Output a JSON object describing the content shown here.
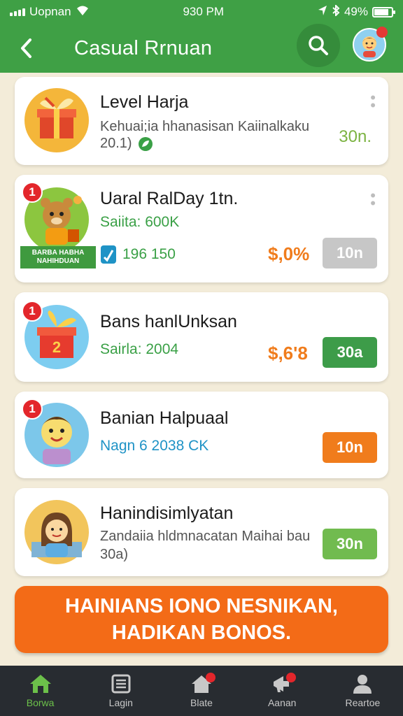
{
  "status_bar": {
    "carrier": "Uopnan",
    "time": "930 PM",
    "battery": "49%"
  },
  "header": {
    "title": "Casual Rrnuan"
  },
  "items": [
    {
      "title": "Level Harja",
      "line1": "Kehuai;ia hhanasisan Kaiinalkaku",
      "line2": "20.1)",
      "amount": "30n."
    },
    {
      "title": "Uaral RalDay 1tn.",
      "line1": "Saiita: 600K",
      "line2": "196 150",
      "price": "$,0%",
      "button": "10n",
      "badge": "1",
      "ribbon": "BARBA HABHA NAHIHDUAN"
    },
    {
      "title": "Bans hanlUnksan",
      "line1": "Sairla: 2004",
      "price": "$,6'8",
      "button": "30a",
      "badge": "1"
    },
    {
      "title": "Banian Halpuaal",
      "line1": "Nagn 6 2038 CK",
      "button": "10n",
      "badge": "1"
    },
    {
      "title": "Hanindisimlyatan",
      "line1": "Zandaiia hldmnacatan Maihai bau",
      "line2": "30a)",
      "button": "30n"
    }
  ],
  "banner": {
    "line1": "HAINIANS IONO NESNIKAN,",
    "line2": "HADIKAN BONOS."
  },
  "tabs": [
    {
      "label": "Borwa"
    },
    {
      "label": "Lagin"
    },
    {
      "label": "Blate"
    },
    {
      "label": "Aanan"
    },
    {
      "label": "Reartoe"
    }
  ],
  "colors": {
    "primary_green": "#3fa045",
    "orange": "#f36b17",
    "gray_button": "#c7c7c7",
    "dark_green_button": "#3d9c49",
    "light_green_button": "#71bb4f"
  }
}
